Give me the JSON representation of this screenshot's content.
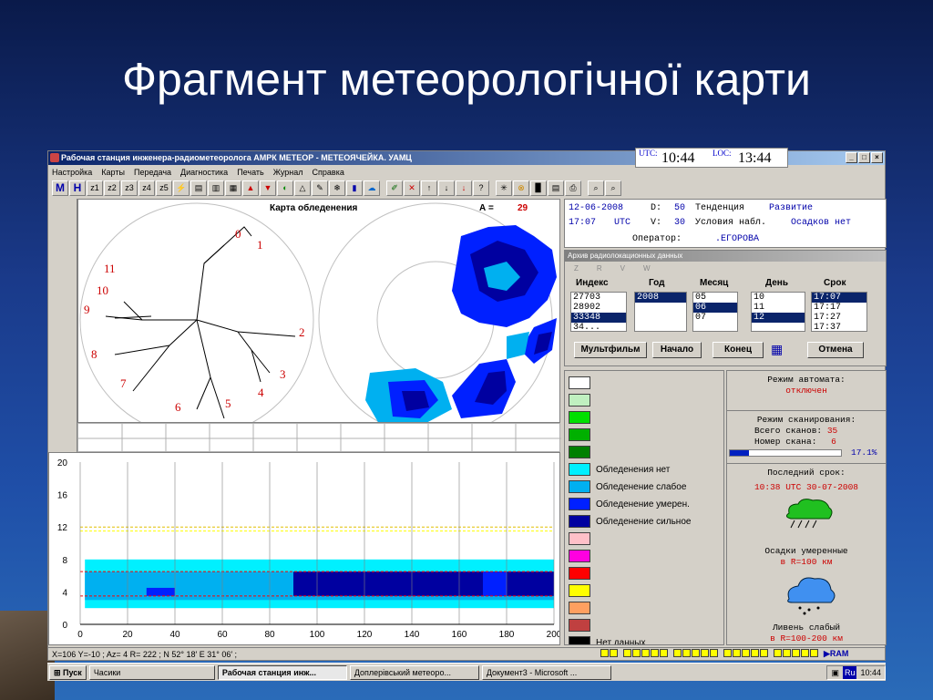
{
  "slide": {
    "title": "Фрагмент метеорологічної карти"
  },
  "window": {
    "title": "Рабочая станция инженера-радиометеоролога АМРК МЕТЕОР - МЕТЕОЯЧЕЙКА. УАМЦ",
    "clock": {
      "utc_label": "UTC:",
      "utc_value": "10:44",
      "loc_label": "LOC:",
      "loc_value": "13:44"
    },
    "menu": [
      "Настройка",
      "Карты",
      "Передача",
      "Диагностика",
      "Печать",
      "Журнал",
      "Справка"
    ],
    "toolbar": [
      "M",
      "H",
      "z1",
      "z2",
      "z3",
      "z4",
      "z5"
    ]
  },
  "map": {
    "title": "Карта обледенения",
    "a_label": "А =",
    "a_value": "29",
    "direction_labels": [
      "0",
      "1",
      "2",
      "3",
      "4",
      "5",
      "6",
      "7",
      "8",
      "9",
      "10",
      "11"
    ]
  },
  "info": {
    "date": "12-06-2008",
    "d_label": "D:",
    "d_value": "50",
    "trend_label": "Тенденция",
    "trend_value": "Развитие",
    "time": "17:07",
    "utc": "UTC",
    "v_label": "V:",
    "v_value": "30",
    "cond_label": "Условия набл.",
    "cond_value": "Осадков нет",
    "operator_label": "Оператор:",
    "operator_value": ".ЕГОРОВА"
  },
  "archive": {
    "title": "Архив радиолокационных данных",
    "zrvw": [
      "Z",
      "R",
      "V",
      "W"
    ],
    "headers": [
      "Индекс",
      "Год",
      "Месяц",
      "День",
      "Срок"
    ],
    "index_items": [
      "27703",
      "28902",
      "33348",
      "34..."
    ],
    "year_items": [
      "2008"
    ],
    "month_items": [
      "05",
      "06",
      "07"
    ],
    "day_items": [
      "10",
      "11",
      "12"
    ],
    "term_items": [
      "17:07",
      "17:17",
      "17:27",
      "17:37"
    ],
    "buttons": {
      "multifilm": "Мультфильм",
      "start": "Начало",
      "end": "Конец",
      "cancel": "Отмена"
    }
  },
  "legend": {
    "items": [
      {
        "color": "#ffffff",
        "label": ""
      },
      {
        "color": "#c0f0c0",
        "label": ""
      },
      {
        "color": "#00e000",
        "label": ""
      },
      {
        "color": "#00b000",
        "label": ""
      },
      {
        "color": "#008000",
        "label": ""
      },
      {
        "color": "#00f0ff",
        "label": "Обледенения нет"
      },
      {
        "color": "#00b0f0",
        "label": "Обледенение слабое"
      },
      {
        "color": "#0020ff",
        "label": "Обледенение умерен."
      },
      {
        "color": "#0000a0",
        "label": "Обледенение сильное"
      },
      {
        "color": "#ffc0c8",
        "label": ""
      },
      {
        "color": "#ff00e0",
        "label": ""
      },
      {
        "color": "#ff0000",
        "label": ""
      },
      {
        "color": "#ffff00",
        "label": ""
      },
      {
        "color": "#ffa060",
        "label": ""
      },
      {
        "color": "#c04040",
        "label": ""
      },
      {
        "color": "#000000",
        "label": "Нет данных"
      }
    ]
  },
  "status": {
    "auto_mode_label": "Режим автомата:",
    "auto_mode_value": "отключен",
    "scan_mode_label": "Режим сканирования:",
    "total_scans_label": "Всего сканов:",
    "total_scans_value": "35",
    "scan_num_label": "Номер скана:",
    "scan_num_value": "6",
    "progress_value": "17.1%",
    "progress_fraction": 0.171,
    "last_term_label": "Последний срок:",
    "last_term_value": "10:38 UTC 30-07-2008",
    "precip_moderate": "Осадки умеренные",
    "precip_moderate_range": "в R=100 км",
    "shower_weak": "Ливень слабый",
    "shower_weak_range": "в R=100-200 км"
  },
  "chart_data": {
    "type": "heatmap",
    "x_ticks": [
      "0",
      "20",
      "40",
      "60",
      "80",
      "100",
      "120",
      "140",
      "160",
      "180",
      "200"
    ],
    "y_ticks": [
      "20",
      "16",
      "12",
      "8",
      "4",
      "0"
    ],
    "xlim": [
      0,
      200
    ],
    "ylim": [
      0,
      20
    ]
  },
  "statusbar": {
    "text": "X=106  Y=-10 ;    Az=     4 R=  222 ;    N 52° 18′  E 31° 06′ ;"
  },
  "taskbar": {
    "start": "Пуск",
    "tasks": [
      "Часики",
      "Рабочая станция инж...",
      "Доплерівський метеоро...",
      "Документ3 - Microsoft ..."
    ],
    "tray_lang": "Ru",
    "tray_time": "10:44"
  },
  "icons": {
    "app": "app-icon",
    "legend_brand": "ram-logo-icon"
  }
}
